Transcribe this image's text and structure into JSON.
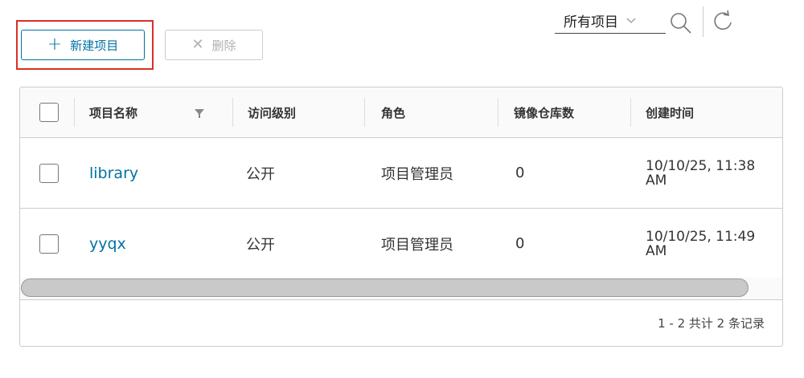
{
  "toolbar": {
    "new_project_label": "新建项目",
    "new_project_icon": "plus-icon",
    "delete_label": "删除",
    "delete_icon": "close-icon",
    "filter_value": "所有项目",
    "search_icon": "search-icon",
    "refresh_icon": "refresh-icon",
    "highlight_color": "#d93025",
    "accent_color": "#0072a3"
  },
  "table": {
    "headers": {
      "name": "项目名称",
      "access": "访问级别",
      "role": "角色",
      "repo_count": "镜像仓库数",
      "created": "创建时间"
    },
    "rows": [
      {
        "name": "library",
        "access": "公开",
        "role": "项目管理员",
        "repo_count": "0",
        "created_line1": "10/10/25, 11:38",
        "created_line2": "AM"
      },
      {
        "name": "yyqx",
        "access": "公开",
        "role": "项目管理员",
        "repo_count": "0",
        "created_line1": "10/10/25, 11:49",
        "created_line2": "AM"
      }
    ],
    "footer_text": "1 - 2 共计 2 条记录"
  }
}
